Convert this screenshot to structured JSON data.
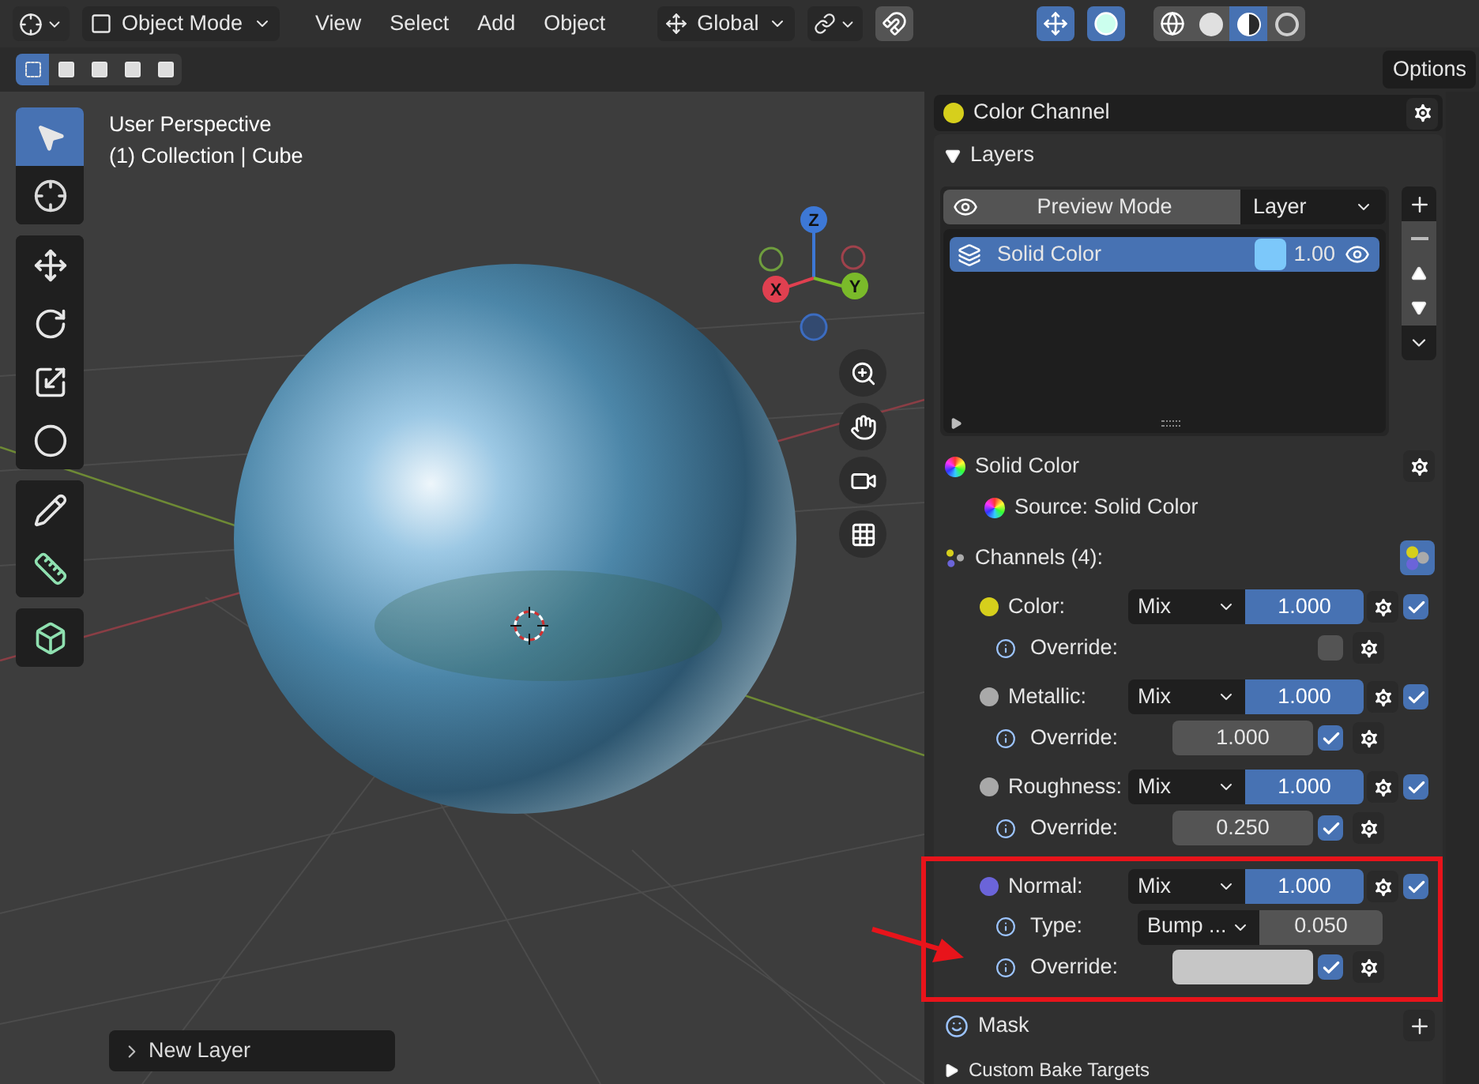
{
  "header": {
    "mode": "Object Mode",
    "menus": [
      "View",
      "Select",
      "Add",
      "Object"
    ],
    "orientation": "Global",
    "toggles": [
      {
        "kind": "snap",
        "on": false
      },
      {
        "kind": "gizmo",
        "on": true
      },
      {
        "kind": "overlay",
        "on": true
      }
    ],
    "shading": [
      {
        "kind": "wireframe",
        "selected": false
      },
      {
        "kind": "solid",
        "selected": false
      },
      {
        "kind": "material",
        "selected": true
      },
      {
        "kind": "rendered",
        "selected": false
      }
    ]
  },
  "tool_settings": {
    "select_modes": [
      {
        "selected": true
      },
      {
        "selected": false
      },
      {
        "selected": false
      },
      {
        "selected": false
      },
      {
        "selected": false
      }
    ],
    "options": "Options"
  },
  "viewport": {
    "view_name": "User Perspective",
    "context": "(1) Collection | Cube",
    "tools": [
      {
        "kind": "select",
        "selected": true
      },
      {
        "kind": "cursor",
        "selected": false
      },
      {
        "kind": "move",
        "selected": false
      },
      {
        "kind": "rotate",
        "selected": false
      },
      {
        "kind": "scale",
        "selected": false
      },
      {
        "kind": "transform",
        "selected": false
      },
      {
        "kind": "annotate",
        "selected": false
      },
      {
        "kind": "measure",
        "selected": false
      },
      {
        "kind": "add-cube",
        "selected": false
      }
    ],
    "gizmo_labels": [
      "Z",
      "X",
      "Y"
    ],
    "last_operator": "New Layer"
  },
  "panel": {
    "channel": "Color Channel",
    "layers_title": "Layers",
    "layers_expanded": true,
    "preview_mode": "Preview Mode",
    "layer_type": "Layer",
    "layers": [
      {
        "name": "Solid Color",
        "opacity": "1.00",
        "color": "#7cc8fa",
        "visible": true,
        "selected": true
      }
    ],
    "layer_title": "Solid Color",
    "source": "Source: Solid Color",
    "channels_title": "Channels (4):",
    "channels": [
      {
        "name": "Color:",
        "color": "#d6cf1c",
        "blend": "Mix",
        "value": "1.000",
        "enabled": true,
        "highlighted": false,
        "override": {
          "label": "Override:",
          "kind": "empty",
          "checked": false
        }
      },
      {
        "name": "Metallic:",
        "color": "#a9a9a9",
        "blend": "Mix",
        "value": "1.000",
        "enabled": true,
        "highlighted": false,
        "override": {
          "label": "Override:",
          "kind": "value",
          "value": "1.000",
          "checked": true
        }
      },
      {
        "name": "Roughness:",
        "color": "#a8a8a8",
        "blend": "Mix",
        "value": "1.000",
        "enabled": true,
        "highlighted": false,
        "override": {
          "label": "Override:",
          "kind": "value",
          "value": "0.250",
          "checked": true
        }
      },
      {
        "name": "Normal:",
        "color": "#6b64d9",
        "blend": "Mix",
        "value": "1.000",
        "enabled": true,
        "highlighted": true,
        "type": {
          "label": "Type:",
          "value": "Bump ...",
          "strength": "0.050"
        },
        "override": {
          "label": "Override:",
          "kind": "swatch",
          "checked": true
        }
      }
    ],
    "mask": "Mask",
    "bake": "Custom Bake Targets"
  }
}
